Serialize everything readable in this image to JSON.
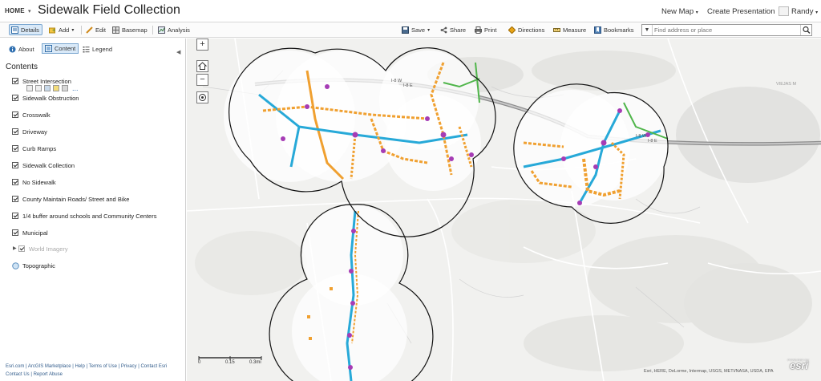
{
  "header": {
    "home_label": "HOME",
    "title": "Sidewalk Field Collection",
    "new_map_label": "New Map",
    "create_presentation_label": "Create Presentation",
    "user_name": "Randy"
  },
  "toolbar": {
    "details_label": "Details",
    "add_label": "Add",
    "edit_label": "Edit",
    "basemap_label": "Basemap",
    "analysis_label": "Analysis",
    "save_label": "Save",
    "share_label": "Share",
    "print_label": "Print",
    "directions_label": "Directions",
    "measure_label": "Measure",
    "bookmarks_label": "Bookmarks",
    "search_placeholder": "Find address or place"
  },
  "sidebar": {
    "tabs": [
      {
        "label": "About",
        "active": false
      },
      {
        "label": "Content",
        "active": true
      },
      {
        "label": "Legend",
        "active": false
      }
    ],
    "contents_title": "Contents",
    "layers": [
      {
        "label": "Street Intersection",
        "checked": true,
        "dim": false
      },
      {
        "label": "Sidewalk Obstruction",
        "checked": true,
        "dim": false
      },
      {
        "label": "Crosswalk",
        "checked": true,
        "dim": false
      },
      {
        "label": "Driveway",
        "checked": true,
        "dim": false
      },
      {
        "label": "Curb Ramps",
        "checked": true,
        "dim": false
      },
      {
        "label": "Sidewalk Collection",
        "checked": true,
        "dim": false
      },
      {
        "label": "No Sidewalk",
        "checked": true,
        "dim": false
      },
      {
        "label": "County Maintain Roads/ Street and Bike",
        "checked": true,
        "dim": false
      },
      {
        "label": "1/4 buffer around schools and Community Centers",
        "checked": true,
        "dim": false
      },
      {
        "label": "Municipal",
        "checked": true,
        "dim": false
      },
      {
        "label": "World Imagery",
        "checked": true,
        "dim": true
      },
      {
        "label": "Topographic",
        "checked": false,
        "dim": false
      }
    ],
    "layer_tools_more": "...",
    "footer_links": [
      "Esri.com",
      "ArcGIS Marketplace",
      "Help",
      "Terms of Use",
      "Privacy",
      "Contact Esri",
      "Contact Us",
      "Report Abuse"
    ]
  },
  "map": {
    "zoom_in": "+",
    "zoom_out": "−",
    "scale_labels": [
      "0",
      "0.15",
      "0.3mi"
    ],
    "attribution": "Esri, HERE, DeLorme, Intermap, USGS, METI/NASA, USDA, EPA",
    "logo_text": "esri",
    "logo_tag": "POWERED BY",
    "road_labels": [
      "I-8 W",
      "I-8 E",
      "VIEJAS M"
    ],
    "colors": {
      "sidewalk": "#f0a030",
      "crosswalk": "#27a9d8",
      "intersection": "#a63cb5",
      "ramp": "#d84dd8",
      "road": "#4fb54a",
      "buffer": "#111111",
      "highway": "#9c9c9c"
    }
  }
}
